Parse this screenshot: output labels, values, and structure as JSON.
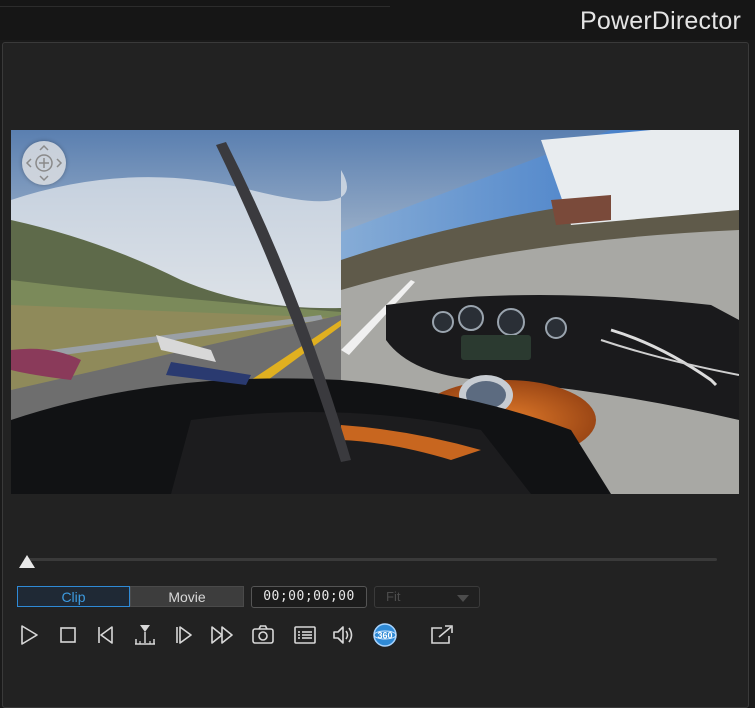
{
  "app": {
    "title": "PowerDirector"
  },
  "viewer": {
    "navigation_control": "360-navigation-control"
  },
  "playback": {
    "mode_clip": "Clip",
    "mode_movie": "Movie",
    "selected_mode": "Clip",
    "timecode": "00;00;00;00",
    "zoom_placeholder": "Fit",
    "position_fraction": 0.0
  },
  "toolbar": {
    "icons": [
      "play-icon",
      "stop-icon",
      "previous-frame-icon",
      "split-icon",
      "next-frame-icon",
      "fast-forward-icon",
      "snapshot-icon",
      "subtitles-icon",
      "volume-icon",
      "360-view-icon",
      "undock-icon"
    ],
    "label_360": "360"
  },
  "colors": {
    "accent": "#2f8ad6",
    "background": "#1a1a1a",
    "panel": "#222222"
  }
}
